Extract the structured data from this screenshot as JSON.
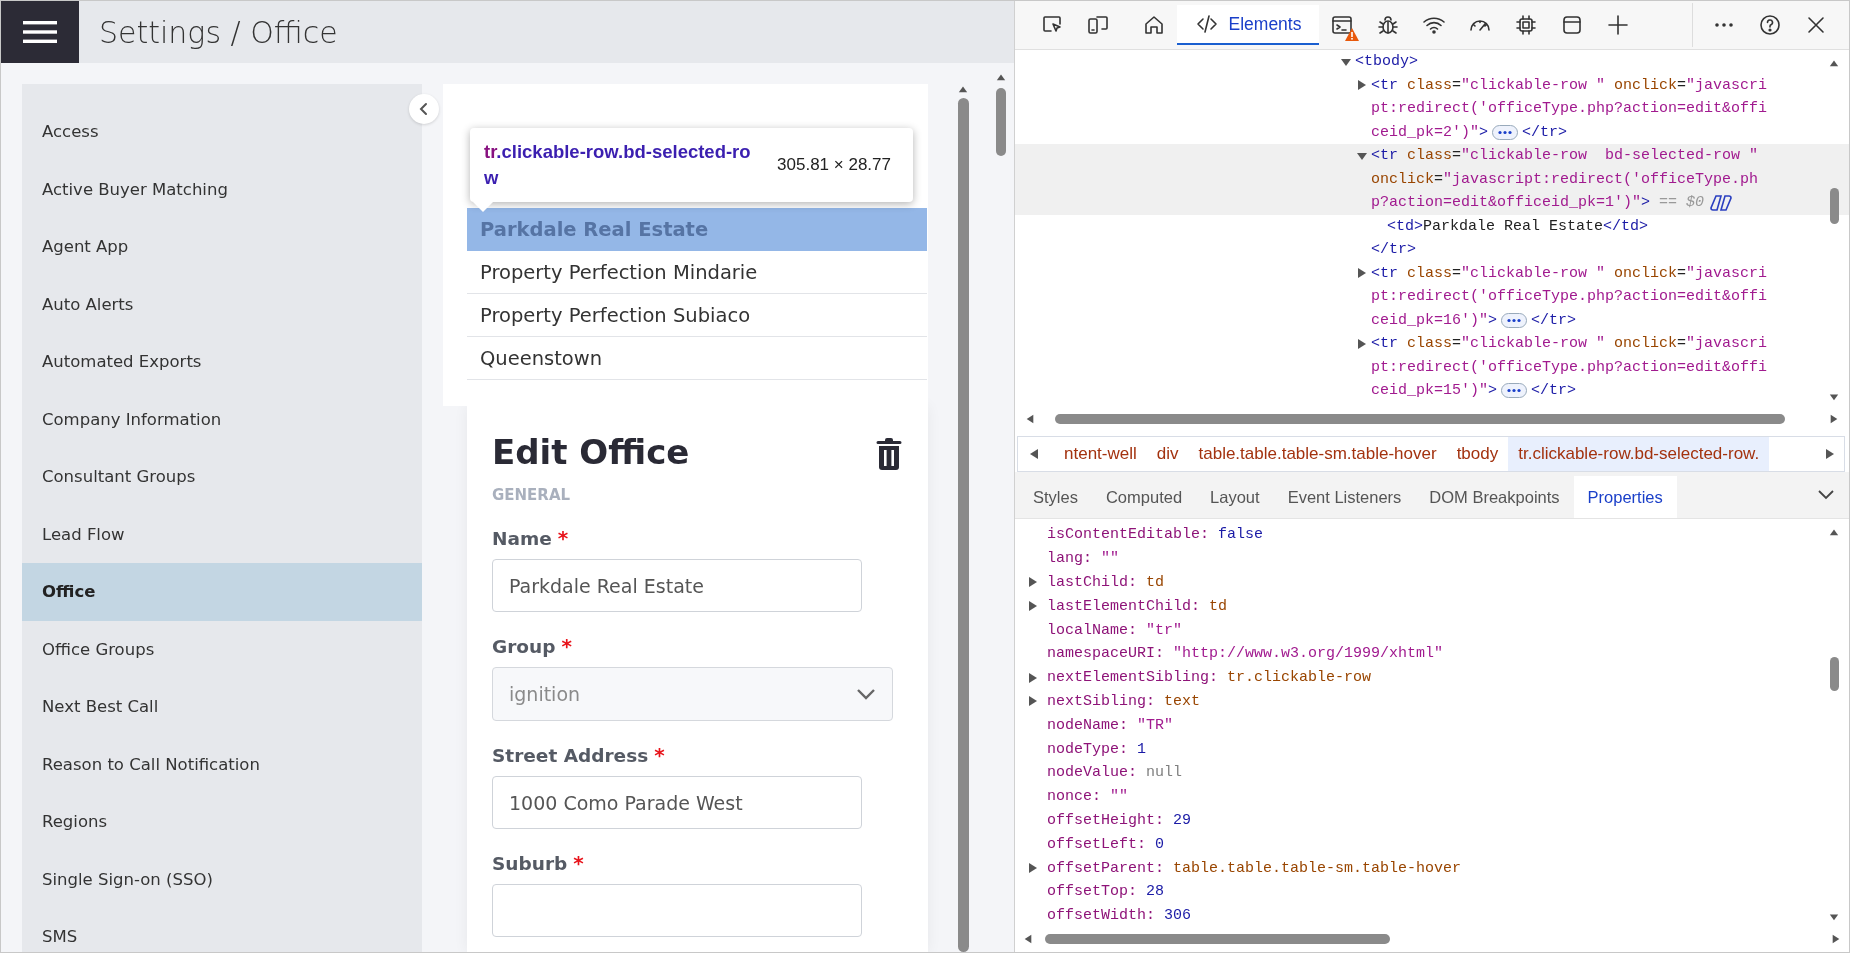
{
  "header": {
    "title": "Settings / Office"
  },
  "sidebar": {
    "items": [
      {
        "label": "Access",
        "selected": false
      },
      {
        "label": "Active Buyer Matching",
        "selected": false
      },
      {
        "label": "Agent App",
        "selected": false
      },
      {
        "label": "Auto Alerts",
        "selected": false
      },
      {
        "label": "Automated Exports",
        "selected": false
      },
      {
        "label": "Company Information",
        "selected": false
      },
      {
        "label": "Consultant Groups",
        "selected": false
      },
      {
        "label": "Lead Flow",
        "selected": false
      },
      {
        "label": "Office",
        "selected": true
      },
      {
        "label": "Office Groups",
        "selected": false
      },
      {
        "label": "Next Best Call",
        "selected": false
      },
      {
        "label": "Reason to Call Notification",
        "selected": false
      },
      {
        "label": "Regions",
        "selected": false
      },
      {
        "label": "Single Sign-on (SSO)",
        "selected": false
      },
      {
        "label": "SMS",
        "selected": false
      }
    ]
  },
  "office_list": {
    "rows": [
      {
        "name": "Parkdale Real Estate",
        "selected": true
      },
      {
        "name": "Property Perfection Mindarie",
        "selected": false
      },
      {
        "name": "Property Perfection Subiaco",
        "selected": false
      },
      {
        "name": "Queenstown",
        "selected": false
      }
    ]
  },
  "inspect_tooltip": {
    "tag": "tr",
    "classes": ".clickable-row.bd-selected-row",
    "size": "305.81 × 28.77"
  },
  "edit_office": {
    "title": "Edit Office",
    "section": "GENERAL",
    "fields": [
      {
        "kind": "text",
        "label": "Name",
        "required_mark": "*",
        "value": "Parkdale Real Estate"
      },
      {
        "kind": "select",
        "label": "Group",
        "required_mark": "*",
        "disabled": true,
        "value": "ignition"
      },
      {
        "kind": "text",
        "label": "Street Address",
        "required_mark": "*",
        "value": "1000 Como Parade West"
      },
      {
        "kind": "text",
        "label": "Suburb",
        "required_mark": "*"
      }
    ]
  },
  "devtools": {
    "tools": [
      {
        "kind": "inspect"
      },
      {
        "kind": "device"
      }
    ],
    "tabs": [
      {
        "kind": "home",
        "selected": false,
        "warning": false
      },
      {
        "kind": "elements",
        "label": "Elements",
        "selected": true,
        "warning": false
      },
      {
        "kind": "console",
        "selected": false,
        "warning": true
      },
      {
        "kind": "bug",
        "selected": false,
        "warning": false
      },
      {
        "kind": "wifi",
        "selected": false,
        "warning": false
      },
      {
        "kind": "gauge",
        "selected": false,
        "warning": false
      },
      {
        "kind": "chip",
        "selected": false,
        "warning": false
      },
      {
        "kind": "window",
        "selected": false,
        "warning": false
      },
      {
        "kind": "add",
        "selected": false,
        "warning": false
      }
    ],
    "actions": [
      {
        "kind": "more"
      },
      {
        "kind": "help"
      },
      {
        "kind": "close"
      }
    ],
    "dom": {
      "nodes": [
        {
          "expanded": true,
          "selected": false,
          "lines": [
            [
              {
                "kind": "tag",
                "text": "<tbody>"
              }
            ]
          ],
          "children": [
            {
              "expanded": false,
              "selected": false,
              "lines": [
                [
                  {
                    "kind": "tag",
                    "text": "<tr"
                  },
                  {
                    "kind": "attr",
                    "text": " class"
                  },
                  {
                    "kind": "punct",
                    "text": "="
                  },
                  {
                    "kind": "val",
                    "text": "\"clickable-row \""
                  },
                  {
                    "kind": "attr",
                    "text": " onclick"
                  },
                  {
                    "kind": "punct",
                    "text": "="
                  },
                  {
                    "kind": "val",
                    "text": "\"javascri"
                  }
                ],
                [
                  {
                    "kind": "val",
                    "text": "pt:redirect('officeType.php?action=edit&offi"
                  }
                ],
                [
                  {
                    "kind": "val",
                    "text": "ceid_pk=2')\""
                  },
                  {
                    "kind": "tag",
                    "text": ">"
                  }
                ]
              ],
              "tail": [
                {
                  "kind": "tag",
                  "text": "</tr>"
                }
              ]
            },
            {
              "expanded": true,
              "selected": true,
              "lines": [
                [
                  {
                    "kind": "tag",
                    "text": "<tr"
                  },
                  {
                    "kind": "attr",
                    "text": " class"
                  },
                  {
                    "kind": "punct",
                    "text": "="
                  },
                  {
                    "kind": "val",
                    "text": "\"clickable-row  bd-selected-row \""
                  }
                ],
                [
                  {
                    "kind": "attr",
                    "text": "onclick"
                  },
                  {
                    "kind": "punct",
                    "text": "="
                  },
                  {
                    "kind": "val",
                    "text": "\"javascript:redirect('officeType.ph"
                  }
                ],
                [
                  {
                    "kind": "val",
                    "text": "p?action=edit&officeid_pk=1')\""
                  },
                  {
                    "kind": "tag",
                    "text": ">"
                  },
                  {
                    "kind": "dim",
                    "text": " == $0"
                  }
                ]
              ],
              "children": [
                {
                  "selected": false,
                  "lines": [
                    [
                      {
                        "kind": "tag",
                        "text": "<td>"
                      },
                      {
                        "kind": "text",
                        "text": "Parkdale Real Estate"
                      },
                      {
                        "kind": "tag",
                        "text": "</td>"
                      }
                    ]
                  ]
                }
              ],
              "close": [
                {
                  "kind": "tag",
                  "text": "</tr>"
                }
              ]
            },
            {
              "expanded": false,
              "selected": false,
              "lines": [
                [
                  {
                    "kind": "tag",
                    "text": "<tr"
                  },
                  {
                    "kind": "attr",
                    "text": " class"
                  },
                  {
                    "kind": "punct",
                    "text": "="
                  },
                  {
                    "kind": "val",
                    "text": "\"clickable-row \""
                  },
                  {
                    "kind": "attr",
                    "text": " onclick"
                  },
                  {
                    "kind": "punct",
                    "text": "="
                  },
                  {
                    "kind": "val",
                    "text": "\"javascri"
                  }
                ],
                [
                  {
                    "kind": "val",
                    "text": "pt:redirect('officeType.php?action=edit&offi"
                  }
                ],
                [
                  {
                    "kind": "val",
                    "text": "ceid_pk=16')\""
                  },
                  {
                    "kind": "tag",
                    "text": ">"
                  }
                ]
              ],
              "tail": [
                {
                  "kind": "tag",
                  "text": "</tr>"
                }
              ]
            },
            {
              "expanded": false,
              "selected": false,
              "lines": [
                [
                  {
                    "kind": "tag",
                    "text": "<tr"
                  },
                  {
                    "kind": "attr",
                    "text": " class"
                  },
                  {
                    "kind": "punct",
                    "text": "="
                  },
                  {
                    "kind": "val",
                    "text": "\"clickable-row \""
                  },
                  {
                    "kind": "attr",
                    "text": " onclick"
                  },
                  {
                    "kind": "punct",
                    "text": "="
                  },
                  {
                    "kind": "val",
                    "text": "\"javascri"
                  }
                ],
                [
                  {
                    "kind": "val",
                    "text": "pt:redirect('officeType.php?action=edit&offi"
                  }
                ],
                [
                  {
                    "kind": "val",
                    "text": "ceid_pk=15')\""
                  },
                  {
                    "kind": "tag",
                    "text": ">"
                  }
                ]
              ],
              "tail": [
                {
                  "kind": "tag",
                  "text": "</tr>"
                }
              ]
            }
          ]
        }
      ]
    },
    "breadcrumbs": [
      {
        "label": "ntent-well",
        "selected": false
      },
      {
        "label": "div",
        "selected": false
      },
      {
        "label": "table.table.table-sm.table-hover",
        "selected": false
      },
      {
        "label": "tbody",
        "selected": false
      },
      {
        "label": "tr.clickable-row.bd-selected-row.",
        "selected": true
      }
    ],
    "panel_tabs": [
      {
        "label": "Styles",
        "selected": false
      },
      {
        "label": "Computed",
        "selected": false
      },
      {
        "label": "Layout",
        "selected": false
      },
      {
        "label": "Event Listeners",
        "selected": false
      },
      {
        "label": "DOM Breakpoints",
        "selected": false
      },
      {
        "label": "Properties",
        "selected": true
      }
    ],
    "properties": [
      {
        "key": "isContentEditable:",
        "value": "false",
        "kind": "keyword",
        "expandable": false
      },
      {
        "key": "lang:",
        "value": "\"\"",
        "kind": "string",
        "expandable": false
      },
      {
        "key": "lastChild:",
        "value": "td",
        "kind": "object",
        "expandable": true
      },
      {
        "key": "lastElementChild:",
        "value": "td",
        "kind": "object",
        "expandable": true
      },
      {
        "key": "localName:",
        "value": "\"tr\"",
        "kind": "string",
        "expandable": false
      },
      {
        "key": "namespaceURI:",
        "value": "\"http://www.w3.org/1999/xhtml\"",
        "kind": "string",
        "expandable": false
      },
      {
        "key": "nextElementSibling:",
        "value": "tr.clickable-row",
        "kind": "object",
        "expandable": true
      },
      {
        "key": "nextSibling:",
        "value": "text",
        "kind": "object",
        "expandable": true
      },
      {
        "key": "nodeName:",
        "value": "\"TR\"",
        "kind": "string",
        "expandable": false
      },
      {
        "key": "nodeType:",
        "value": "1",
        "kind": "number",
        "expandable": false
      },
      {
        "key": "nodeValue:",
        "value": "null",
        "kind": "null",
        "expandable": false
      },
      {
        "key": "nonce:",
        "value": "\"\"",
        "kind": "string",
        "expandable": false
      },
      {
        "key": "offsetHeight:",
        "value": "29",
        "kind": "number",
        "expandable": false
      },
      {
        "key": "offsetLeft:",
        "value": "0",
        "kind": "number",
        "expandable": false
      },
      {
        "key": "offsetParent:",
        "value": "table.table.table-sm.table-hover",
        "kind": "object",
        "expandable": true
      },
      {
        "key": "offsetTop:",
        "value": "28",
        "kind": "number",
        "expandable": false
      },
      {
        "key": "offsetWidth:",
        "value": "306",
        "kind": "number",
        "expandable": false
      }
    ]
  }
}
